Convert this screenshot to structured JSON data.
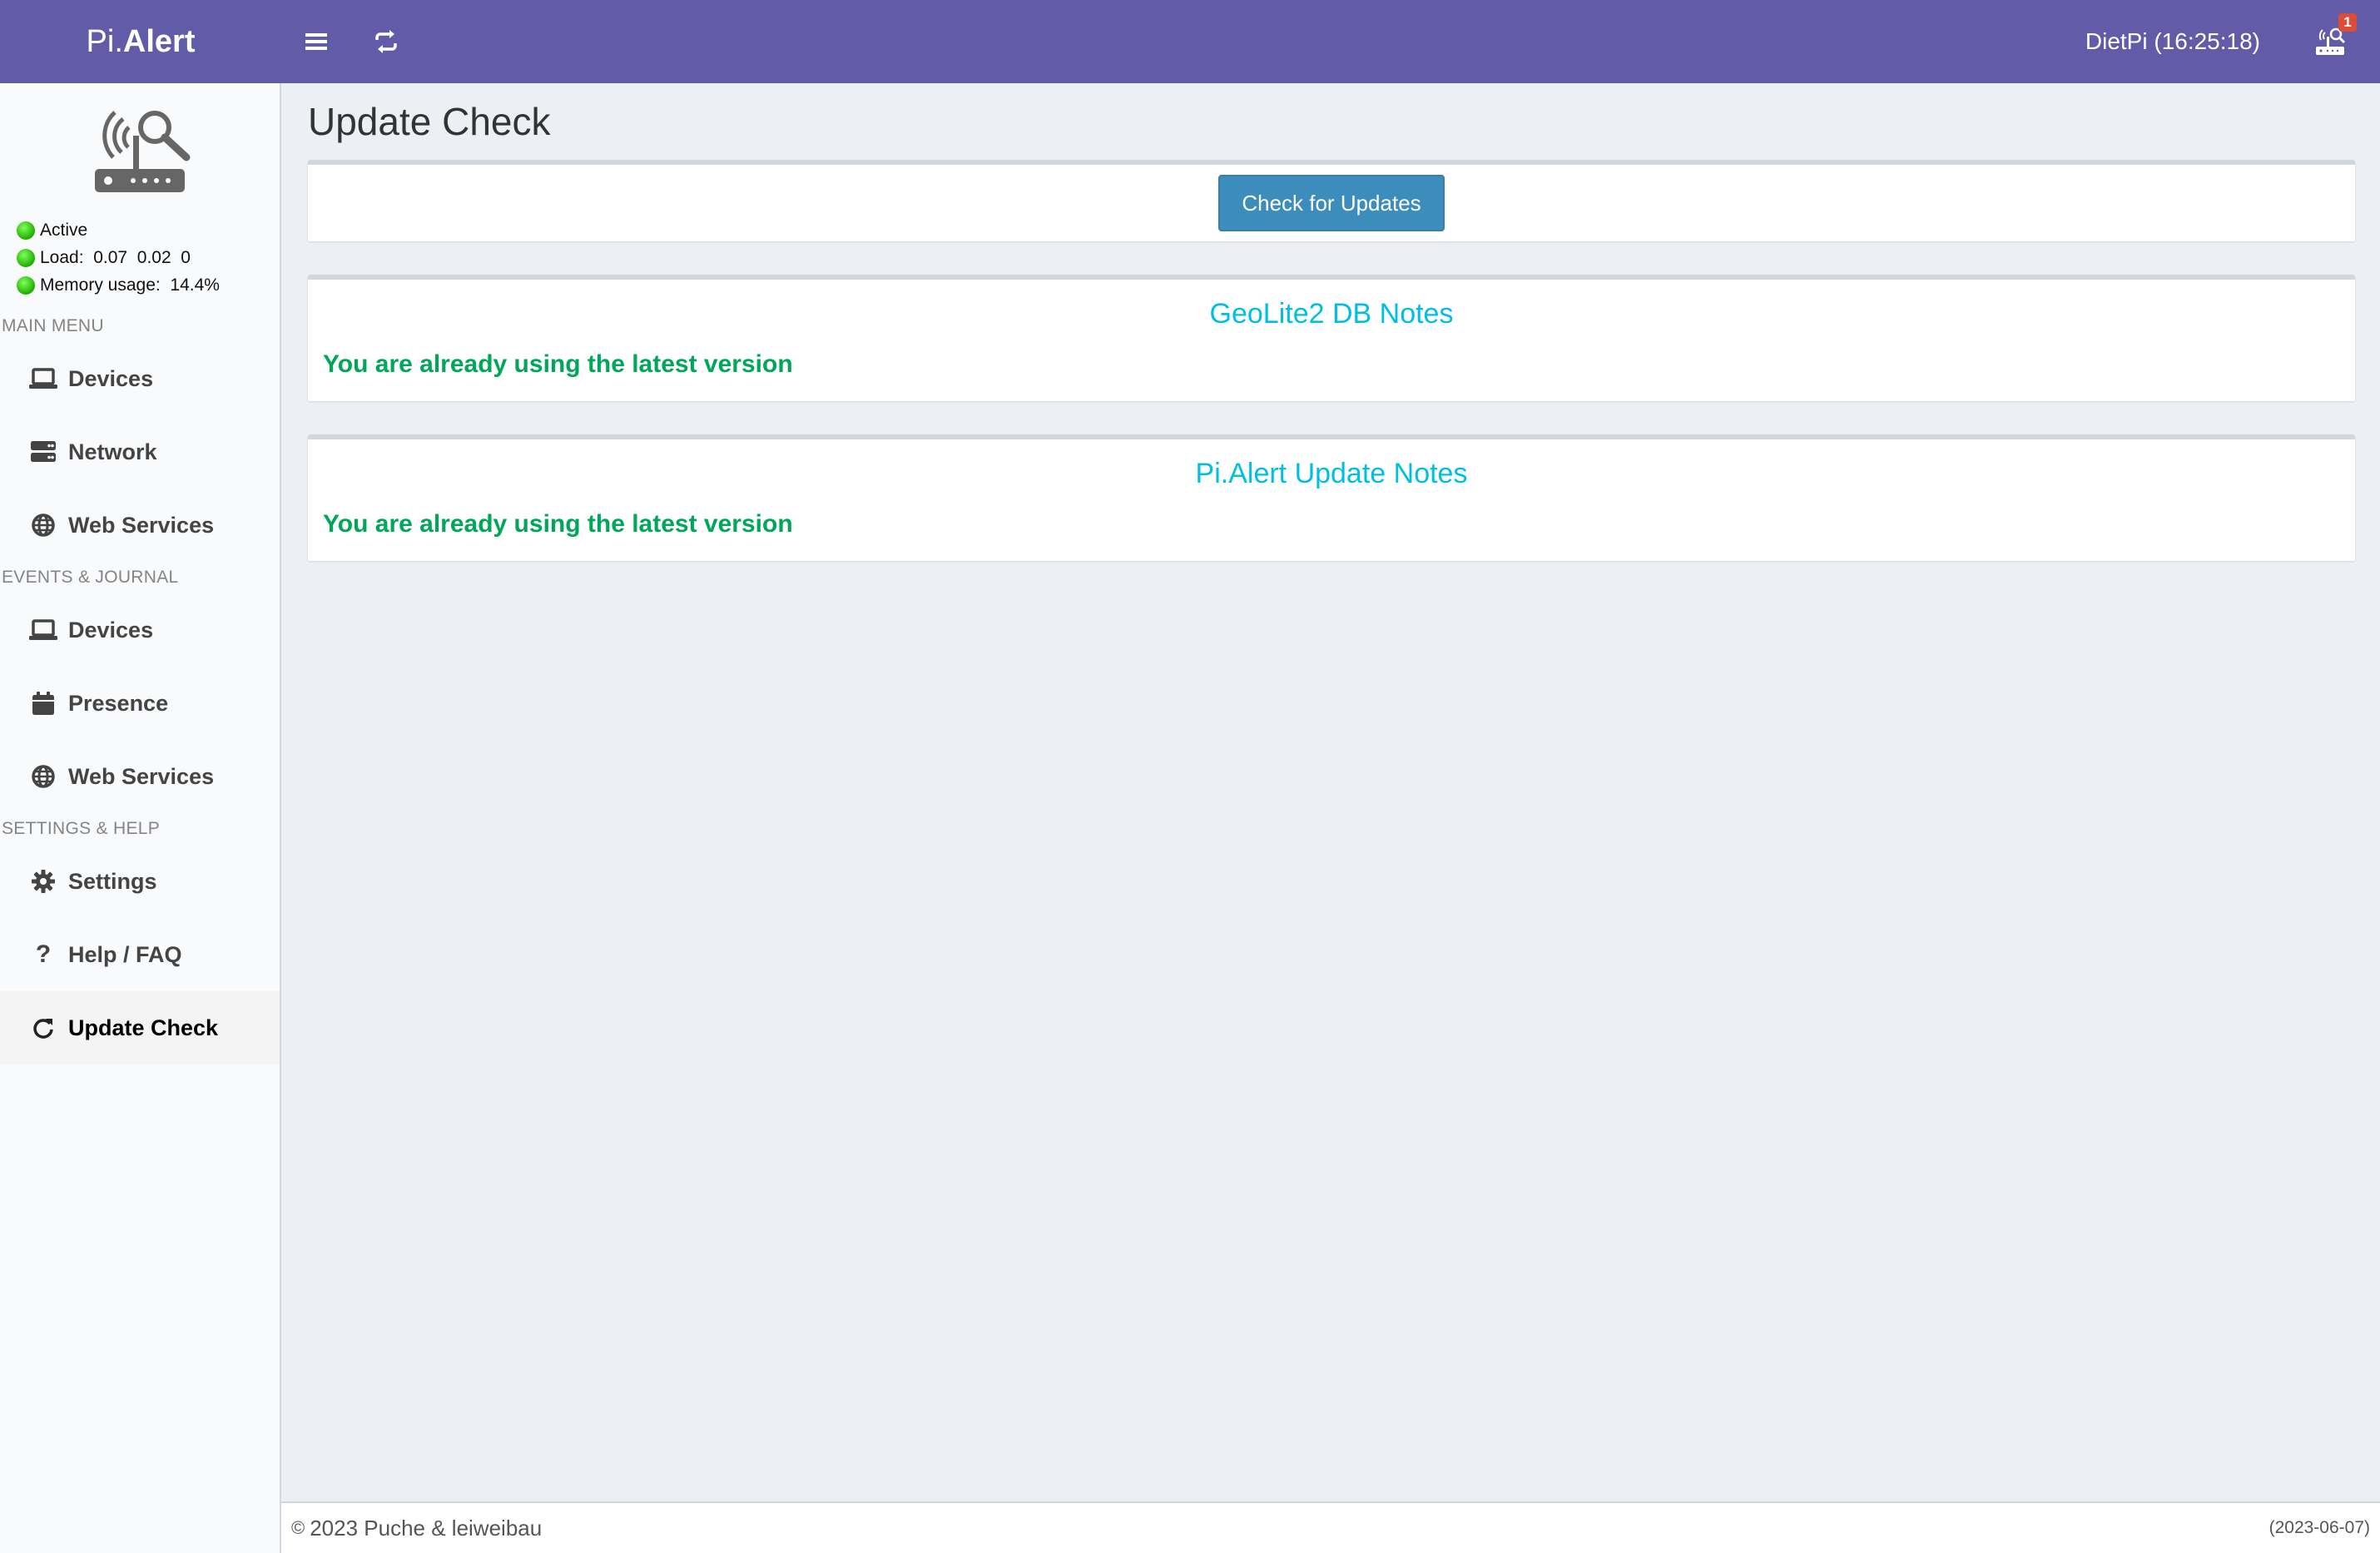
{
  "header": {
    "logo_light": "Pi.",
    "logo_bold": "Alert",
    "hostname_time": "DietPi (16:25:18)",
    "notification_count": "1"
  },
  "sidebar": {
    "status": {
      "active": "Active",
      "load": "Load:  0.07  0.02  0",
      "memory": "Memory usage:  14.4%"
    },
    "sections": [
      {
        "header": "MAIN MENU",
        "items": [
          {
            "label": "Devices",
            "icon": "laptop-icon"
          },
          {
            "label": "Network",
            "icon": "server-icon"
          },
          {
            "label": "Web Services",
            "icon": "globe-icon"
          }
        ]
      },
      {
        "header": "EVENTS & JOURNAL",
        "items": [
          {
            "label": "Devices",
            "icon": "laptop-icon"
          },
          {
            "label": "Presence",
            "icon": "calendar-icon"
          },
          {
            "label": "Web Services",
            "icon": "globe-icon"
          }
        ]
      },
      {
        "header": "SETTINGS & HELP",
        "items": [
          {
            "label": "Settings",
            "icon": "gear-icon"
          },
          {
            "label": "Help / FAQ",
            "icon": "question-icon"
          },
          {
            "label": "Update Check",
            "icon": "refresh-icon",
            "active": true
          }
        ]
      }
    ]
  },
  "main": {
    "title": "Update Check",
    "check_button": "Check for Updates",
    "geolite": {
      "title": "GeoLite2 DB Notes",
      "message": "You are already using the latest version"
    },
    "pialert": {
      "title": "Pi.Alert Update Notes",
      "message": "You are already using the latest version"
    }
  },
  "footer": {
    "copyright": "2023 Puche & leiweibau",
    "version_date": "(2023-06-07)"
  },
  "colors": {
    "header_bg": "#605ca8",
    "accent_blue": "#3c8dbc",
    "note_title": "#00bfe3",
    "success_green": "#00a65a"
  }
}
